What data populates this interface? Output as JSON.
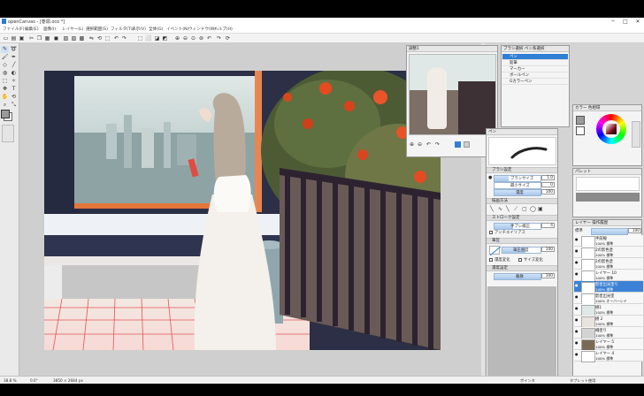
{
  "titlebar": {
    "title": "openCanvas - [巻頭.oco *]",
    "minimize": "─",
    "maximize": "□",
    "close": "✕"
  },
  "menu": [
    "ファイル(F)",
    "編集(E)",
    "画像(I)",
    "レイヤー(L)",
    "選択範囲(S)",
    "フィルタ(T)",
    "表示(V)",
    "全体(G)",
    "イベント(N)",
    "ウィンドウ(W)",
    "ヘルプ(H)"
  ],
  "navigator": {
    "title": "調整1",
    "zoom_icons": [
      "⊕",
      "⊖",
      "↶",
      "↷"
    ]
  },
  "brush_list": {
    "title": "ブラシ選択 ペン系選択",
    "items": [
      "ペン",
      "鉛筆",
      "マーカー",
      "ボールペン",
      "Gカラーペン"
    ],
    "selected": 0
  },
  "brush_settings": {
    "title": "ペン",
    "sec_brush": "ブラシ設定",
    "size_label": "ブラシサイズ",
    "size_value": "1.0",
    "min_label": "最小サイズ",
    "min_value": "0",
    "opacity_label": "濃度",
    "opacity_value": "100",
    "sec_shape": "描画方法",
    "sec_stroke": "ストローク設定",
    "hand_label": "手ブレ補正",
    "hand_value": "4",
    "stroke_extra": "アンチエイリアス",
    "sec_pressure": "筆圧",
    "press_label": "筆圧感度",
    "press_value": "100",
    "press_opt1": "濃度変化",
    "press_opt2": "サイズ変化",
    "sec_texture": "濃度設定",
    "texture_label": "離散",
    "texture_value": "100"
  },
  "color_panel": {
    "title": "カラー 色相環"
  },
  "palette_panel": {
    "title": "パレット"
  },
  "layers": {
    "title": "レイヤー 操作履歴",
    "mode": "標準",
    "opacity": "100",
    "items": [
      {
        "name": "手前線",
        "mode": "100% 標準",
        "thumb": "#ffffff"
      },
      {
        "name": "2の影色塗",
        "mode": "100% 標準",
        "thumb": "#ffffff"
      },
      {
        "name": "2の影色塗",
        "mode": "100% 標準",
        "thumb": "#ffffff"
      },
      {
        "name": "レイヤー 10",
        "mode": "100% 標準",
        "thumb": "#ffffff"
      },
      {
        "name": "影塗出光塗り",
        "mode": "100% 標準",
        "thumb": "#ffffff"
      },
      {
        "name": "影塗出光塗",
        "mode": "100% オーバーレイ",
        "thumb": "#ffffff"
      },
      {
        "name": "樹1",
        "mode": "100% 標準",
        "thumb": "#dfe8e6"
      },
      {
        "name": "樹 2",
        "mode": "100% 標準",
        "thumb": "#e9e3dd"
      },
      {
        "name": "柵塗り",
        "mode": "100% 標準",
        "thumb": "#d3d3d3"
      },
      {
        "name": "レイヤー 5",
        "mode": "100% 標準",
        "thumb": "#7a6a55"
      },
      {
        "name": "レイヤー 4",
        "mode": "100% 標準",
        "thumb": "#ffffff"
      }
    ],
    "selected": 4
  },
  "status": {
    "zoom": "38.8 %",
    "angle": "0.0°",
    "size": "3850 × 2684 px",
    "right1": "ポインタ",
    "right2": "タブレット使用"
  },
  "colors": {
    "accent": "#2f7fd3",
    "bg": "#d4d4d4"
  }
}
